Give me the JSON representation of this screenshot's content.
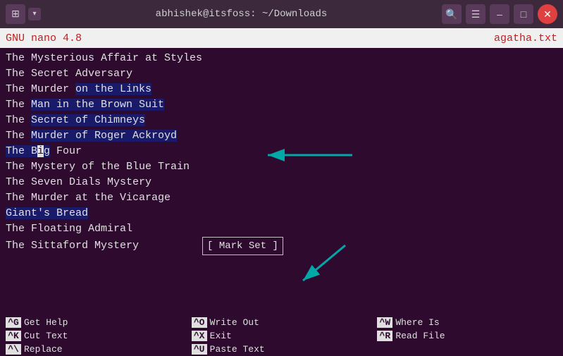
{
  "titlebar": {
    "title": "abhishek@itsfoss: ~/Downloads",
    "icon": "⊞",
    "dropdown_arrow": "▾",
    "buttons": {
      "search": "🔍",
      "menu": "☰",
      "minimize": "–",
      "maximize": "□",
      "close": "✕"
    }
  },
  "nano_header": {
    "left": "GNU nano 4.8",
    "right": "agatha.txt"
  },
  "lines": [
    "The Mysterious Affair at Styles",
    "The Secret Adversary",
    "The Murder on the Links",
    "The Man in the Brown Suit",
    "The Secret of Chimneys",
    "The Murder of Roger Ackroyd",
    "The Big Four",
    "The Mystery of the Blue Train",
    "The Seven Dials Mystery",
    "The Murder at the Vicarage",
    "Giant's Bread",
    "The Floating Admiral",
    "The Sittaford Mystery"
  ],
  "mark_set": "[ Mark Set ]",
  "footer": {
    "items": [
      {
        "key": "^G",
        "label": "Get Help"
      },
      {
        "key": "^O",
        "label": "Write Out"
      },
      {
        "key": "^W",
        "label": "Where Is"
      },
      {
        "key": "^K",
        "label": "Cut Text"
      },
      {
        "key": "^X",
        "label": "Exit"
      },
      {
        "key": "^R",
        "label": "Read File"
      },
      {
        "key": "^\\",
        "label": "Replace"
      },
      {
        "key": "^U",
        "label": "Paste Text"
      }
    ]
  }
}
